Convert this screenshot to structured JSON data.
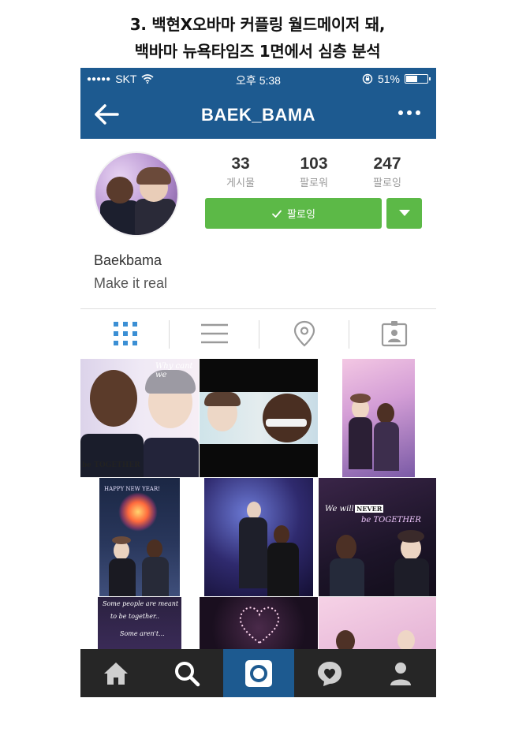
{
  "caption": {
    "line1": "3. 백현X오바마 커플링 월드메이저 돼,",
    "line2": "백바마 뉴욕타임즈 1면에서 심층 분석"
  },
  "status_bar": {
    "carrier": "SKT",
    "signal_dots": "●●●●●",
    "time": "오후 5:38",
    "battery": "51%",
    "battery_level": 0.51
  },
  "navbar": {
    "username": "BAEK_BAMA",
    "back_icon": "arrow-left-icon",
    "more_icon": "more-dots-icon"
  },
  "profile": {
    "stats": [
      {
        "value": "33",
        "label": "게시물"
      },
      {
        "value": "103",
        "label": "팔로워"
      },
      {
        "value": "247",
        "label": "팔로잉"
      }
    ],
    "follow_button": "팔로잉",
    "name": "Baekbama",
    "bio": "Make it real"
  },
  "view_tabs": [
    {
      "name": "grid-view",
      "icon": "grid-icon",
      "active": true
    },
    {
      "name": "list-view",
      "icon": "list-icon",
      "active": false
    },
    {
      "name": "location-view",
      "icon": "location-pin-icon",
      "active": false
    },
    {
      "name": "tagged-view",
      "icon": "tagged-person-icon",
      "active": false
    }
  ],
  "posts": {
    "post_1_text": "Why cant we",
    "post_1_caption": "be TOGETHER",
    "post_4_text": "HAPPY NEW YEAR!",
    "post_6_line1": "We will",
    "post_6_word": "NEVER",
    "post_6_line2": "be TOGETHER",
    "post_7_line1": "Some people are meant",
    "post_7_line2": "to be together..",
    "post_7_line3": "Some aren't..."
  },
  "bottom_tabs": [
    {
      "name": "home",
      "icon": "home-icon"
    },
    {
      "name": "search",
      "icon": "search-icon"
    },
    {
      "name": "camera",
      "icon": "camera-icon",
      "active": true
    },
    {
      "name": "activity",
      "icon": "heart-bubble-icon"
    },
    {
      "name": "profile",
      "icon": "person-icon"
    }
  ],
  "colors": {
    "header_blue": "#1d5a90",
    "follow_green": "#5cb947",
    "tabbar_dark": "#262626"
  }
}
